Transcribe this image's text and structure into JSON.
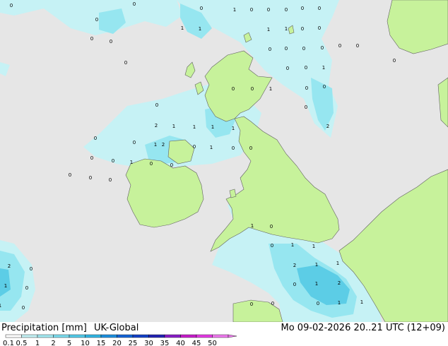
{
  "header": {
    "variable": "Precipitation [mm]",
    "model": "UK-Global",
    "datetime": "Mo 09-02-2026 20..21 UTC (12+09)"
  },
  "colors": {
    "land": "#c7f29b",
    "sea": "#e6e6e6",
    "precip_light": "#c6f2f5",
    "precip_mid": "#96e6f0",
    "precip_heavy": "#5ccde6",
    "precip_strong": "#33aee0",
    "border": "#606060"
  },
  "legend": {
    "ticks": [
      "0.1",
      "0.5",
      "1",
      "2",
      "5",
      "10",
      "15",
      "20",
      "25",
      "30",
      "35",
      "40",
      "45",
      "50"
    ],
    "colors": [
      "#ffffff",
      "#c6f2f5",
      "#a5eaf2",
      "#7ddcee",
      "#55ccea",
      "#33b7e5",
      "#1e90e0",
      "#1565d8",
      "#1441c8",
      "#2424b4",
      "#8a1ec8",
      "#c81ecc",
      "#e63ce6",
      "#f07cf0"
    ]
  },
  "map_values": [
    {
      "t": "0"
    },
    {
      "t": "0"
    },
    {
      "t": "0"
    },
    {
      "t": "0"
    },
    {
      "t": "0"
    },
    {
      "t": "0"
    },
    {
      "t": "0"
    },
    {
      "t": "1"
    },
    {
      "t": "1"
    },
    {
      "t": "1"
    },
    {
      "t": "0"
    },
    {
      "t": "0"
    },
    {
      "t": "0"
    },
    {
      "t": "0"
    },
    {
      "t": "0"
    },
    {
      "t": "1"
    },
    {
      "t": "1"
    },
    {
      "t": "0"
    },
    {
      "t": "0"
    },
    {
      "t": "0"
    },
    {
      "t": "0"
    },
    {
      "t": "0"
    },
    {
      "t": "0"
    },
    {
      "t": "0"
    },
    {
      "t": "0"
    },
    {
      "t": "0"
    },
    {
      "t": "0"
    },
    {
      "t": "0"
    },
    {
      "t": "1"
    },
    {
      "t": "1"
    },
    {
      "t": "0"
    },
    {
      "t": "0"
    },
    {
      "t": "0"
    },
    {
      "t": "0"
    },
    {
      "t": "0"
    },
    {
      "t": "2"
    },
    {
      "t": "0"
    },
    {
      "t": "2"
    },
    {
      "t": "1"
    },
    {
      "t": "1"
    },
    {
      "t": "1"
    },
    {
      "t": "1"
    },
    {
      "t": "0"
    },
    {
      "t": "0"
    },
    {
      "t": "1"
    },
    {
      "t": "2"
    },
    {
      "t": "0"
    },
    {
      "t": "1"
    },
    {
      "t": "0"
    },
    {
      "t": "0"
    },
    {
      "t": "0"
    },
    {
      "t": "0"
    },
    {
      "t": "1"
    },
    {
      "t": "0"
    },
    {
      "t": "0"
    },
    {
      "t": "0"
    },
    {
      "t": "0"
    },
    {
      "t": "0"
    },
    {
      "t": "1"
    },
    {
      "t": "0"
    },
    {
      "t": "0"
    },
    {
      "t": "1"
    },
    {
      "t": "1"
    },
    {
      "t": "2"
    },
    {
      "t": "1"
    },
    {
      "t": "1"
    },
    {
      "t": "0"
    },
    {
      "t": "1"
    },
    {
      "t": "2"
    },
    {
      "t": "0"
    },
    {
      "t": "1"
    },
    {
      "t": "1"
    },
    {
      "t": "0"
    },
    {
      "t": "0"
    },
    {
      "t": "2"
    },
    {
      "t": "0"
    },
    {
      "t": "1"
    },
    {
      "t": "0"
    },
    {
      "t": "1"
    },
    {
      "t": "0"
    }
  ]
}
